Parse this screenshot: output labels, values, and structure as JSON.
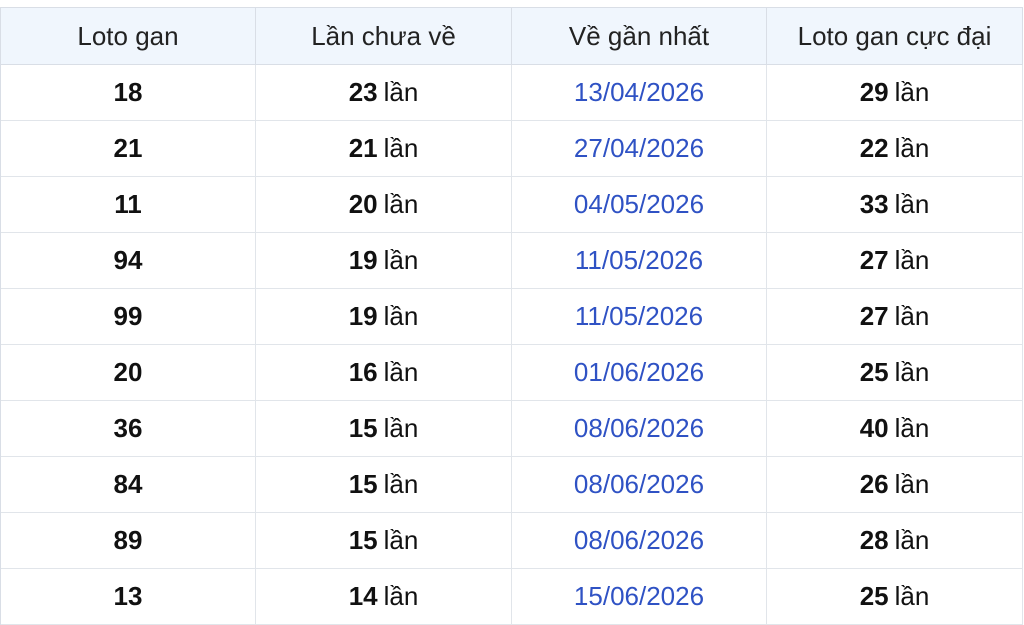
{
  "headers": [
    "Loto gan",
    "Lần chưa về",
    "Về gần nhất",
    "Loto gan cực đại"
  ],
  "unit": "lần",
  "rows": [
    {
      "loto": "18",
      "count": "23",
      "date": "13/04/2026",
      "max": "29"
    },
    {
      "loto": "21",
      "count": "21",
      "date": "27/04/2026",
      "max": "22"
    },
    {
      "loto": "11",
      "count": "20",
      "date": "04/05/2026",
      "max": "33"
    },
    {
      "loto": "94",
      "count": "19",
      "date": "11/05/2026",
      "max": "27"
    },
    {
      "loto": "99",
      "count": "19",
      "date": "11/05/2026",
      "max": "27"
    },
    {
      "loto": "20",
      "count": "16",
      "date": "01/06/2026",
      "max": "25"
    },
    {
      "loto": "36",
      "count": "15",
      "date": "08/06/2026",
      "max": "40"
    },
    {
      "loto": "84",
      "count": "15",
      "date": "08/06/2026",
      "max": "26"
    },
    {
      "loto": "89",
      "count": "15",
      "date": "08/06/2026",
      "max": "28"
    },
    {
      "loto": "13",
      "count": "14",
      "date": "15/06/2026",
      "max": "25"
    }
  ],
  "colors": {
    "header_bg": "#f0f6fd",
    "date_text": "#2f52c4",
    "border": "#e1e5ea"
  }
}
